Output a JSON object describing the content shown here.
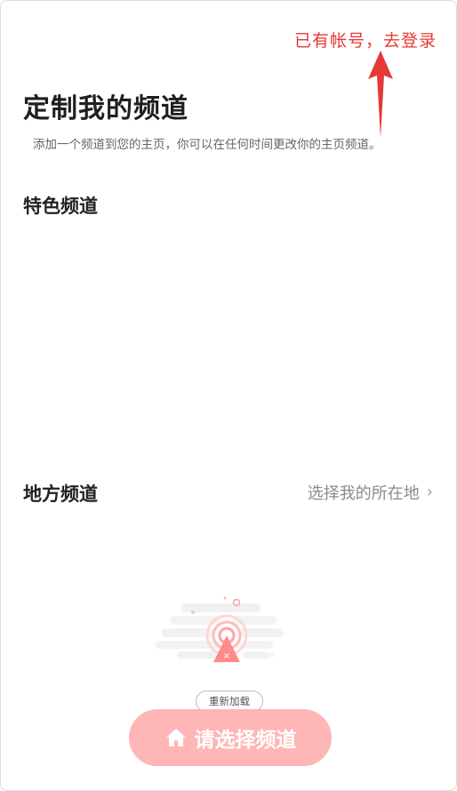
{
  "annotation": {
    "login_hint": "已有帐号，去登录",
    "color": "#e53935"
  },
  "header": {
    "title": "定制我的频道",
    "subtitle": "添加一个频道到您的主页，你可以在任何时间更改你的主页频道。"
  },
  "sections": {
    "featured": {
      "title": "特色频道"
    },
    "local": {
      "title": "地方频道",
      "location_link": "选择我的所在地",
      "chevron": "›"
    }
  },
  "empty_state": {
    "illustration_icon": "signal-error-icon",
    "reload_label": "重新加载"
  },
  "footer": {
    "choose_button": "请选择频道",
    "choose_icon": "home-icon",
    "button_color": "#ffb3b3"
  }
}
